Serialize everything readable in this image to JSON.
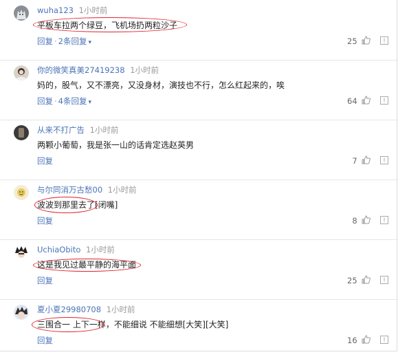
{
  "comments": [
    {
      "username": "wuha123",
      "time": "1小时前",
      "text": "平板车拉两个绿豆，飞机场扔两粒沙子",
      "reply_label": "回复",
      "more_replies": "2条回复",
      "likes": "25",
      "avatar_icon": "wolf-avatar"
    },
    {
      "username": "你的微笑真美27419238",
      "time": "1小时前",
      "text": "妈的，股气，又不漂亮，又没身材，演技也不行，怎么红起来的，唉",
      "reply_label": "回复",
      "more_replies": "4条回复",
      "likes": "64",
      "avatar_icon": "person-avatar"
    },
    {
      "username": "从来不打广告",
      "time": "1小时前",
      "text": "两颗小葡萄，我是张一山的话肯定选赵英男",
      "reply_label": "回复",
      "more_replies": "",
      "likes": "7",
      "avatar_icon": "dark-avatar"
    },
    {
      "username": "与尔同消万古愁00",
      "time": "1小时前",
      "text": "波波到那里去了[闭嘴]",
      "reply_label": "回复",
      "more_replies": "",
      "likes": "8",
      "avatar_icon": "cartoon-avatar"
    },
    {
      "username": "UchiaObito",
      "time": "1小时前",
      "text": "这是我见过最平静的海平面",
      "reply_label": "回复",
      "more_replies": "",
      "likes": "25",
      "avatar_icon": "anime-avatar"
    },
    {
      "username": "夏小夏29980708",
      "time": "1小时前",
      "text": "三围合一 上下一样，不能细说 不能细想[大笑][大笑]",
      "reply_label": "回复",
      "more_replies": "",
      "likes": "16",
      "avatar_icon": "anime-avatar-2"
    }
  ],
  "separator": "·",
  "colors": {
    "username": "#4a73b8",
    "link": "#4a73b8",
    "annotation": "#e0212b"
  }
}
